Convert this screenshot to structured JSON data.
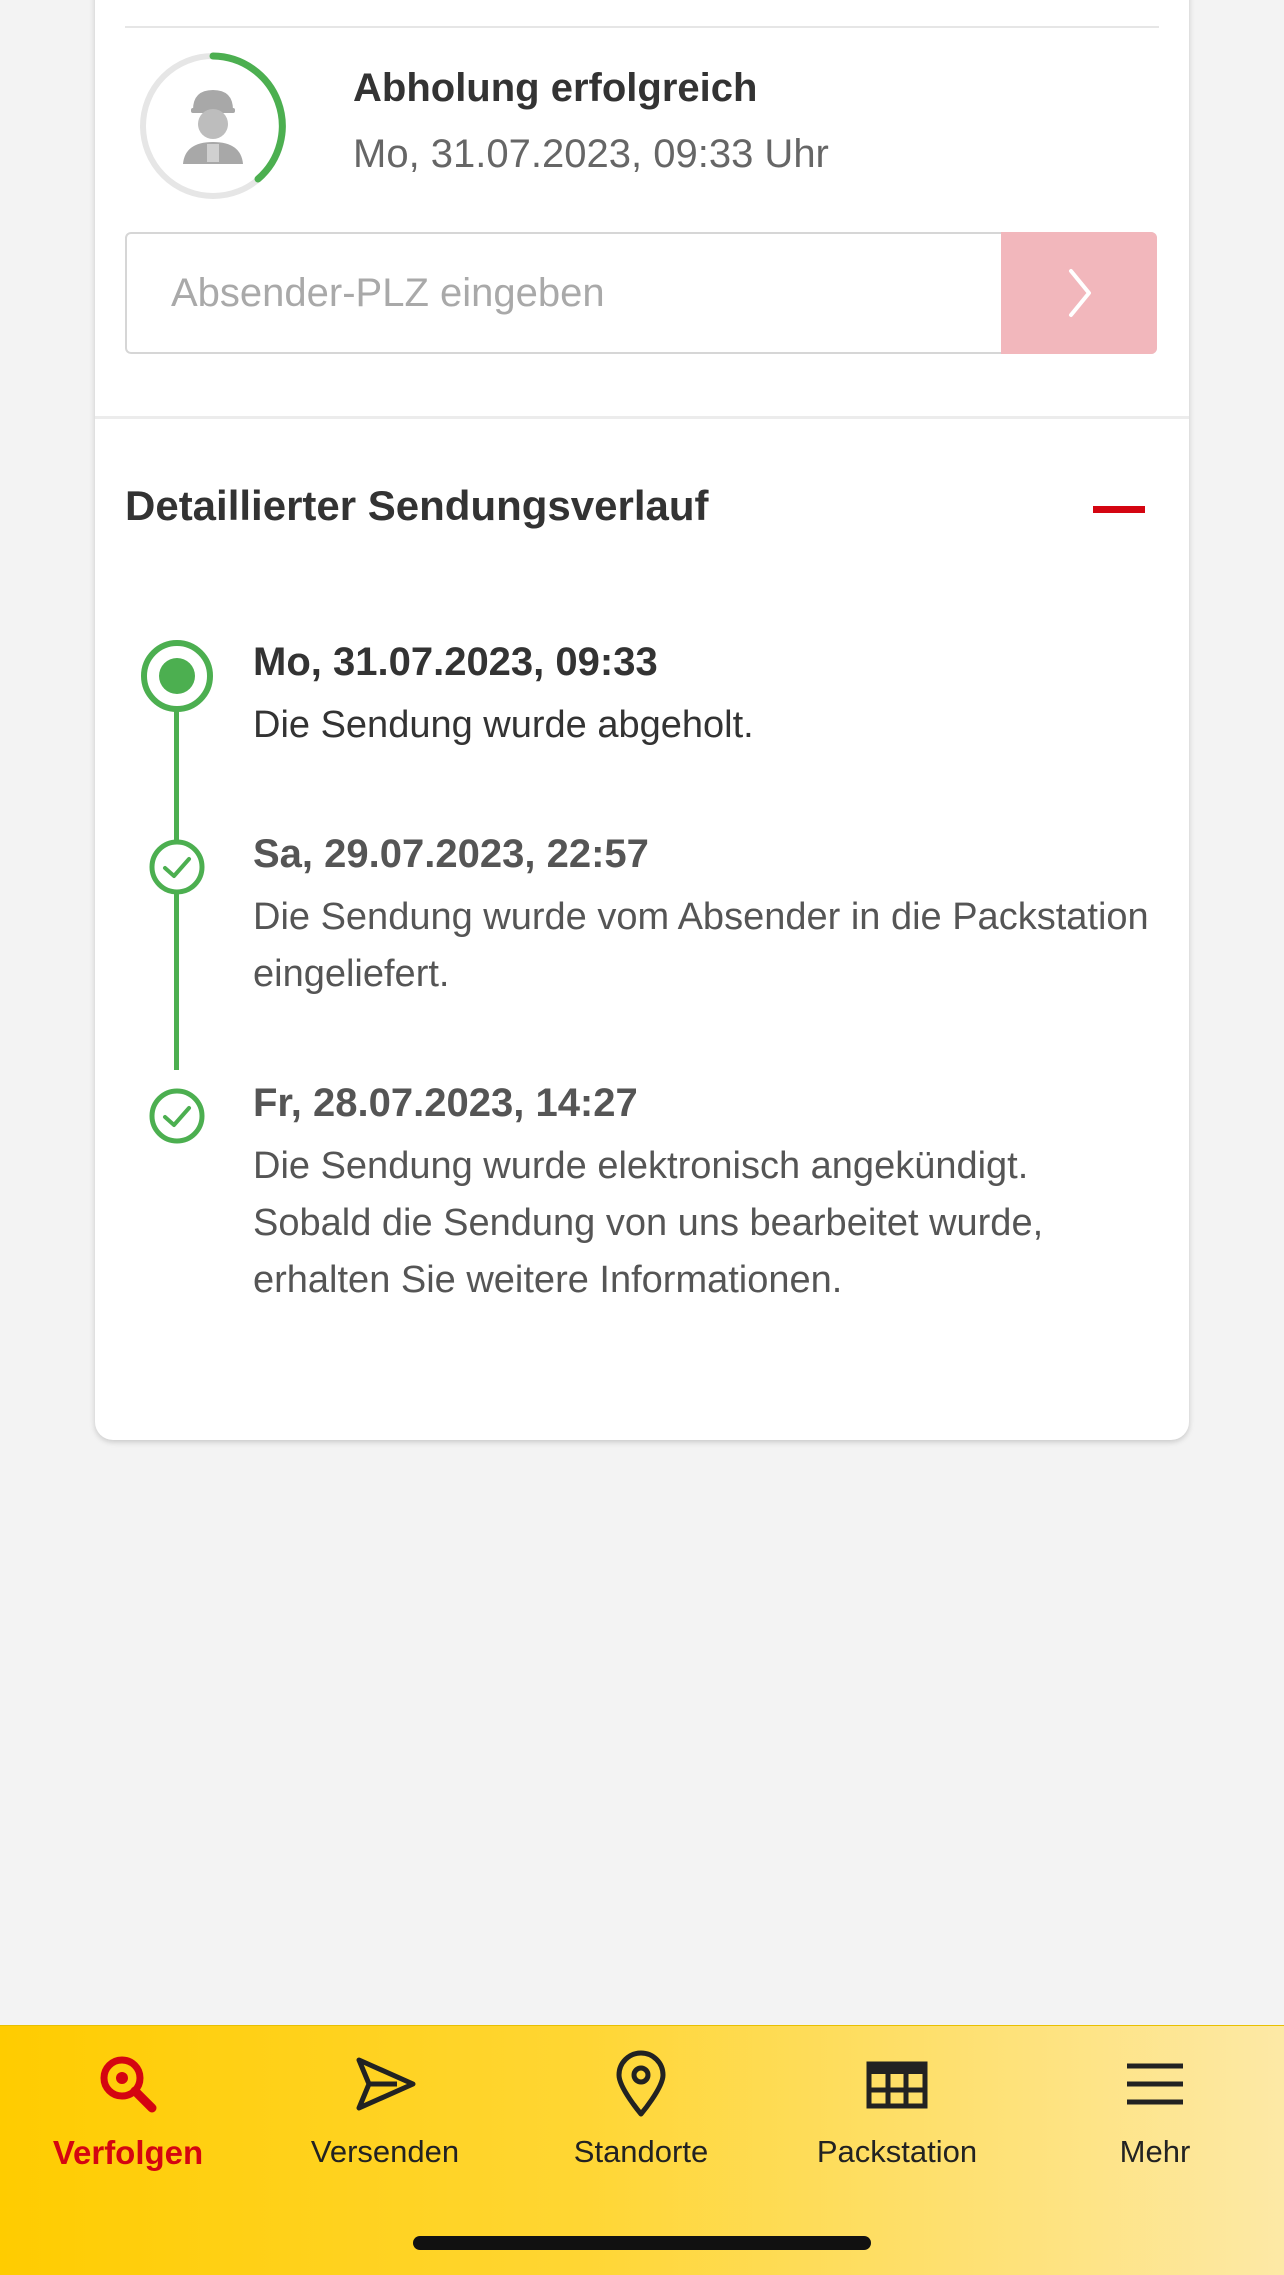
{
  "status": {
    "title": "Abholung erfolgreich",
    "date": "Mo, 31.07.2023, 09:33 Uhr",
    "progress_fraction": 0.42
  },
  "plz": {
    "placeholder": "Absender-PLZ eingeben",
    "submit_icon": "chevron-right-icon"
  },
  "details": {
    "title": "Detaillierter Sendungsverlauf",
    "collapse_icon": "minus-icon",
    "events": [
      {
        "date": "Mo, 31.07.2023, 09:33",
        "text": "Die Sendung wurde abgeholt.",
        "current": true
      },
      {
        "date": "Sa, 29.07.2023, 22:57",
        "text": "Die Sendung wurde vom Absender in die Packstation eingeliefert.",
        "current": false
      },
      {
        "date": "Fr, 28.07.2023, 14:27",
        "text": "Die Sendung wurde elektronisch angekündigt. Sobald die Sendung von uns bearbeitet wurde, erhalten Sie weitere Informationen.",
        "current": false
      }
    ]
  },
  "nav": {
    "items": [
      {
        "label": "Verfolgen",
        "icon": "search-icon",
        "active": true
      },
      {
        "label": "Versenden",
        "icon": "send-icon",
        "active": false
      },
      {
        "label": "Standorte",
        "icon": "location-pin-icon",
        "active": false
      },
      {
        "label": "Packstation",
        "icon": "packstation-icon",
        "active": false
      },
      {
        "label": "Mehr",
        "icon": "menu-icon",
        "active": false
      }
    ]
  },
  "colors": {
    "accent_red": "#d40511",
    "brand_yellow": "#ffcc00",
    "success_green": "#4caf50",
    "submit_disabled": "#f2b7bc"
  }
}
